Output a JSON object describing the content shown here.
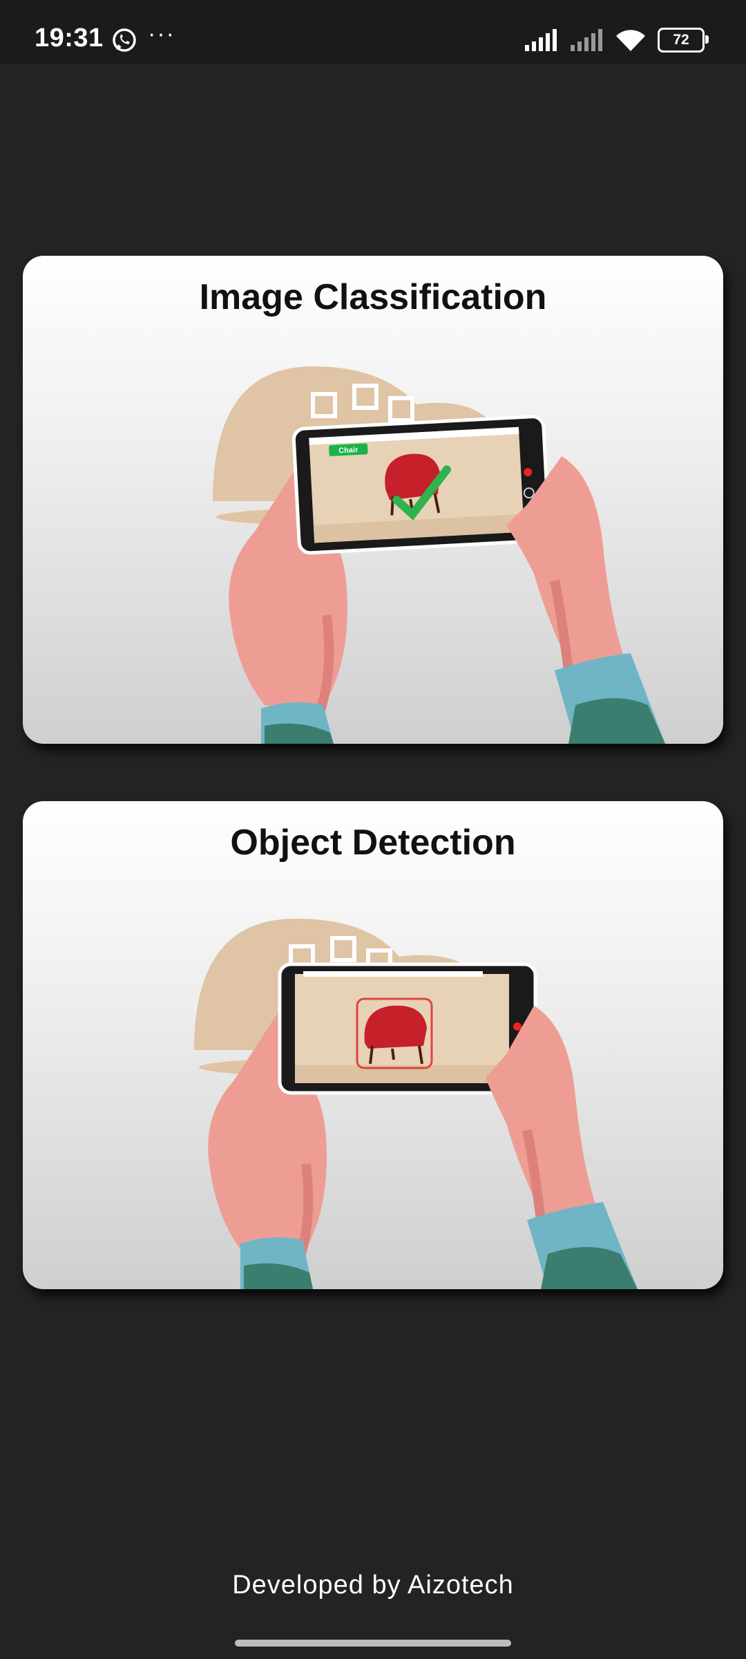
{
  "status": {
    "time": "19:31",
    "dots": "···",
    "battery": "72"
  },
  "cards": [
    {
      "title": "Image Classification",
      "tag": "Chair"
    },
    {
      "title": "Object Detection"
    }
  ],
  "footer": "Developed by Aizotech"
}
